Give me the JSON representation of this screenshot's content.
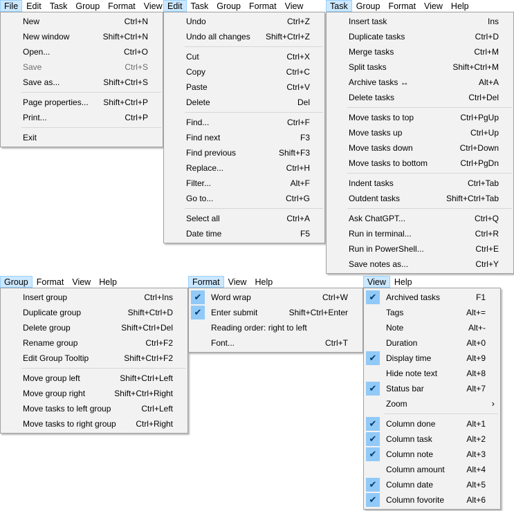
{
  "file_panel": {
    "menubar": [
      "File",
      "Edit",
      "Task",
      "Group",
      "Format",
      "View"
    ],
    "items": [
      {
        "label": "New",
        "shortcut": "Ctrl+N"
      },
      {
        "label": "New window",
        "shortcut": "Shift+Ctrl+N"
      },
      {
        "label": "Open...",
        "shortcut": "Ctrl+O"
      },
      {
        "label": "Save",
        "shortcut": "Ctrl+S",
        "disabled": true
      },
      {
        "label": "Save as...",
        "shortcut": "Shift+Ctrl+S"
      },
      {
        "separator": true
      },
      {
        "label": "Page properties...",
        "shortcut": "Shift+Ctrl+P"
      },
      {
        "label": "Print...",
        "shortcut": "Ctrl+P"
      },
      {
        "separator": true
      },
      {
        "label": "Exit",
        "shortcut": ""
      }
    ]
  },
  "edit_panel": {
    "menubar": [
      "Edit",
      "Task",
      "Group",
      "Format",
      "View"
    ],
    "items": [
      {
        "label": "Undo",
        "shortcut": "Ctrl+Z"
      },
      {
        "label": "Undo all changes",
        "shortcut": "Shift+Ctrl+Z"
      },
      {
        "separator": true
      },
      {
        "label": "Cut",
        "shortcut": "Ctrl+X"
      },
      {
        "label": "Copy",
        "shortcut": "Ctrl+C"
      },
      {
        "label": "Paste",
        "shortcut": "Ctrl+V"
      },
      {
        "label": "Delete",
        "shortcut": "Del"
      },
      {
        "separator": true
      },
      {
        "label": "Find...",
        "shortcut": "Ctrl+F"
      },
      {
        "label": "Find next",
        "shortcut": "F3"
      },
      {
        "label": "Find previous",
        "shortcut": "Shift+F3"
      },
      {
        "label": "Replace...",
        "shortcut": "Ctrl+H"
      },
      {
        "label": "Filter...",
        "shortcut": "Alt+F"
      },
      {
        "label": "Go to...",
        "shortcut": "Ctrl+G"
      },
      {
        "separator": true
      },
      {
        "label": "Select all",
        "shortcut": "Ctrl+A"
      },
      {
        "label": "Date time",
        "shortcut": "F5"
      }
    ]
  },
  "task_panel": {
    "menubar": [
      "Task",
      "Group",
      "Format",
      "View",
      "Help"
    ],
    "items": [
      {
        "label": "Insert task",
        "shortcut": "Ins"
      },
      {
        "label": "Duplicate tasks",
        "shortcut": "Ctrl+D"
      },
      {
        "label": "Merge tasks",
        "shortcut": "Ctrl+M"
      },
      {
        "label": "Split tasks",
        "shortcut": "Shift+Ctrl+M"
      },
      {
        "label": "Archive tasks ↔",
        "shortcut": "Alt+A"
      },
      {
        "label": "Delete tasks",
        "shortcut": "Ctrl+Del"
      },
      {
        "separator": true
      },
      {
        "label": "Move tasks to top",
        "shortcut": "Ctrl+PgUp"
      },
      {
        "label": "Move tasks up",
        "shortcut": "Ctrl+Up"
      },
      {
        "label": "Move tasks down",
        "shortcut": "Ctrl+Down"
      },
      {
        "label": "Move tasks to bottom",
        "shortcut": "Ctrl+PgDn"
      },
      {
        "separator": true
      },
      {
        "label": "Indent tasks",
        "shortcut": "Ctrl+Tab"
      },
      {
        "label": "Outdent tasks",
        "shortcut": "Shift+Ctrl+Tab"
      },
      {
        "separator": true
      },
      {
        "label": "Ask ChatGPT...",
        "shortcut": "Ctrl+Q"
      },
      {
        "label": "Run in terminal...",
        "shortcut": "Ctrl+R"
      },
      {
        "label": "Run in PowerShell...",
        "shortcut": "Ctrl+E"
      },
      {
        "label": "Save notes as...",
        "shortcut": "Ctrl+Y"
      }
    ]
  },
  "group_panel": {
    "menubar": [
      "Group",
      "Format",
      "View",
      "Help"
    ],
    "items": [
      {
        "label": "Insert group",
        "shortcut": "Ctrl+Ins"
      },
      {
        "label": "Duplicate group",
        "shortcut": "Shift+Ctrl+D"
      },
      {
        "label": "Delete group",
        "shortcut": "Shift+Ctrl+Del"
      },
      {
        "label": "Rename group",
        "shortcut": "Ctrl+F2"
      },
      {
        "label": "Edit Group Tooltip",
        "shortcut": "Shift+Ctrl+F2"
      },
      {
        "separator": true
      },
      {
        "label": "Move group left",
        "shortcut": "Shift+Ctrl+Left"
      },
      {
        "label": "Move group right",
        "shortcut": "Shift+Ctrl+Right"
      },
      {
        "label": "Move tasks to left group",
        "shortcut": "Ctrl+Left"
      },
      {
        "label": "Move tasks to right group",
        "shortcut": "Ctrl+Right"
      }
    ]
  },
  "format_panel": {
    "menubar": [
      "Format",
      "View",
      "Help"
    ],
    "items": [
      {
        "label": "Word wrap",
        "shortcut": "Ctrl+W",
        "checked": true
      },
      {
        "label": "Enter submit",
        "shortcut": "Shift+Ctrl+Enter",
        "checked": true
      },
      {
        "label": "Reading order: right to left",
        "shortcut": ""
      },
      {
        "label": "Font...",
        "shortcut": "Ctrl+T"
      }
    ]
  },
  "view_panel": {
    "menubar": [
      "View",
      "Help"
    ],
    "items": [
      {
        "label": "Archived tasks",
        "shortcut": "F1",
        "checked": true
      },
      {
        "label": "Tags",
        "shortcut": "Alt+="
      },
      {
        "label": "Note",
        "shortcut": "Alt+-"
      },
      {
        "label": "Duration",
        "shortcut": "Alt+0"
      },
      {
        "label": "Display time",
        "shortcut": "Alt+9",
        "checked": true
      },
      {
        "label": "Hide note text",
        "shortcut": "Alt+8"
      },
      {
        "label": "Status bar",
        "shortcut": "Alt+7",
        "checked": true
      },
      {
        "label": "Zoom",
        "shortcut": "",
        "submenu": true
      },
      {
        "separator": true
      },
      {
        "label": "Column done",
        "shortcut": "Alt+1",
        "checked": true
      },
      {
        "label": "Column task",
        "shortcut": "Alt+2",
        "checked": true
      },
      {
        "label": "Column note",
        "shortcut": "Alt+3",
        "checked": true
      },
      {
        "label": "Column amount",
        "shortcut": "Alt+4"
      },
      {
        "label": "Column date",
        "shortcut": "Alt+5",
        "checked": true
      },
      {
        "label": "Column fovorite",
        "shortcut": "Alt+6",
        "checked": true
      }
    ]
  },
  "icons": {
    "check": "check-icon",
    "submenu": "chevron-right-icon"
  },
  "colors": {
    "menubar_active_bg": "#cce8ff",
    "menubar_active_border": "#99d1ff",
    "check_bg": "#91c9f7",
    "menu_bg": "#f2f2f2"
  }
}
